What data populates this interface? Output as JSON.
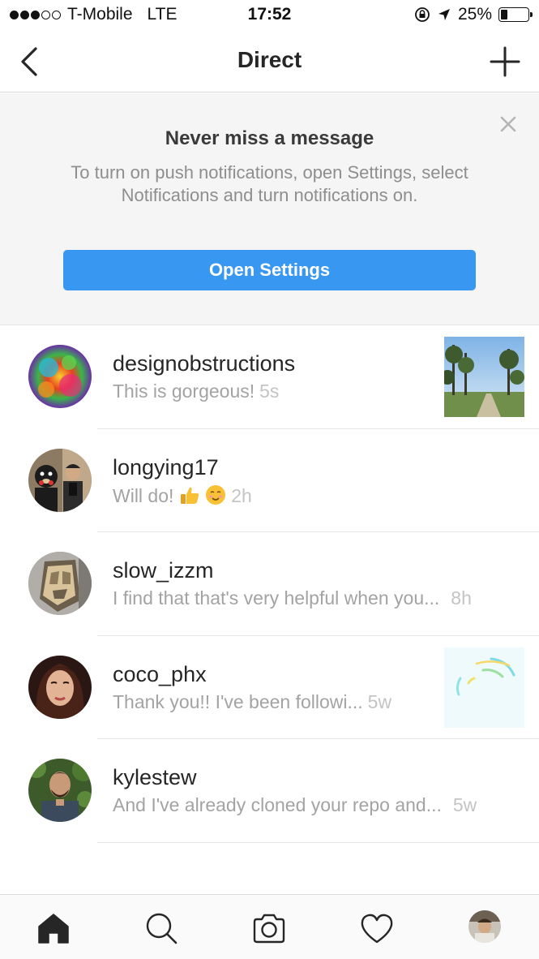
{
  "status_bar": {
    "carrier": "T-Mobile",
    "network": "LTE",
    "time": "17:52",
    "battery": "25%",
    "battery_level": 0.25
  },
  "nav": {
    "title": "Direct",
    "back_icon": "chevron-left-icon",
    "new_icon": "plus-icon"
  },
  "banner": {
    "title": "Never miss a message",
    "text": "To turn on push notifications, open Settings, select Notifications and turn notifications on.",
    "button_label": "Open Settings",
    "button_color": "#3897f0"
  },
  "threads": [
    {
      "username": "designobstructions",
      "preview": "This is gorgeous!",
      "time": "5s",
      "has_thumb": true
    },
    {
      "username": "longying17",
      "preview": "Will do!",
      "time": "2h",
      "has_thumb": false
    },
    {
      "username": "slow_izzm",
      "preview": "I find that that's very helpful when you...",
      "time": "8h",
      "has_thumb": false
    },
    {
      "username": "coco_phx",
      "preview": "Thank you!! I've been followi...",
      "time": "5w",
      "has_thumb": true
    },
    {
      "username": "kylestew",
      "preview": "And I've already cloned your repo and...",
      "time": "5w",
      "has_thumb": false
    }
  ],
  "tabbar": {
    "items": [
      "home-icon",
      "search-icon",
      "camera-icon",
      "heart-icon",
      "profile-avatar"
    ]
  }
}
